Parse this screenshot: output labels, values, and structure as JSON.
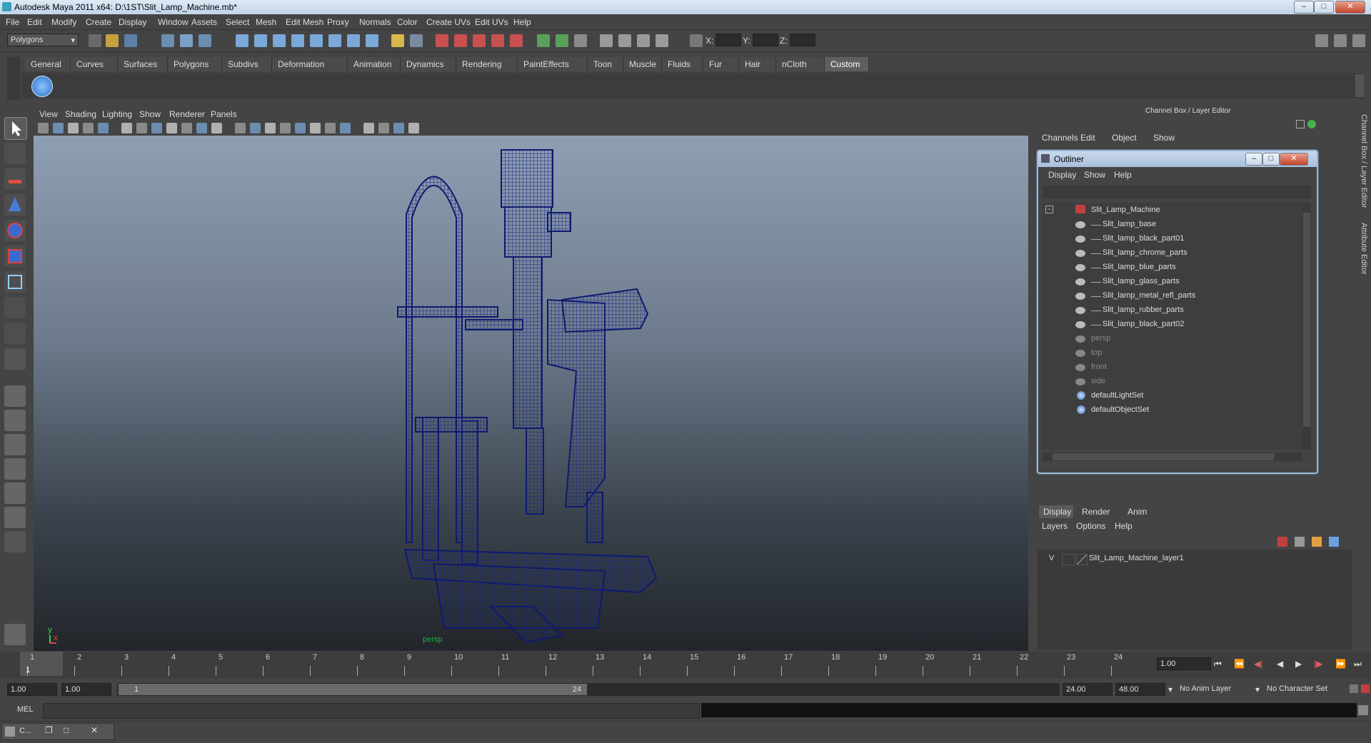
{
  "window": {
    "title": "Autodesk Maya 2011 x64: D:\\1ST\\Slit_Lamp_Machine.mb*"
  },
  "menus": [
    "File",
    "Edit",
    "Modify",
    "Create",
    "Display",
    "Window",
    "Assets",
    "Select",
    "Mesh",
    "Edit Mesh",
    "Proxy",
    "Normals",
    "Color",
    "Create UVs",
    "Edit UVs",
    "Help"
  ],
  "mode_selector": "Polygons",
  "coords": {
    "x_label": "X:",
    "y_label": "Y:",
    "z_label": "Z:"
  },
  "shelf_tabs": [
    "General",
    "Curves",
    "Surfaces",
    "Polygons",
    "Subdivs",
    "Deformation",
    "Animation",
    "Dynamics",
    "Rendering",
    "PaintEffects",
    "Toon",
    "Muscle",
    "Fluids",
    "Fur",
    "Hair",
    "nCloth",
    "Custom"
  ],
  "active_shelf": "Custom",
  "panel_menus": [
    "View",
    "Shading",
    "Lighting",
    "Show",
    "Renderer",
    "Panels"
  ],
  "viewport": {
    "camera_label": "persp",
    "axis_y": "y",
    "axis_x": "x"
  },
  "channel_box": {
    "title": "Channel Box / Layer Editor",
    "menus": [
      "Channels",
      "Edit",
      "Object",
      "Show"
    ],
    "side_tabs": [
      "Channel Box / Layer Editor",
      "Attribute Editor"
    ]
  },
  "outliner": {
    "title": "Outliner",
    "menus": [
      "Display",
      "Show",
      "Help"
    ],
    "root": "Slit_Lamp_Machine",
    "children": [
      "Slit_lamp_base",
      "Slit_lamp_black_part01",
      "Slit_lamp_chrome_parts",
      "Slit_lamp_blue_parts",
      "Slit_lamp_glass_parts",
      "Slit_lamp_metal_refl_parts",
      "Slit_lamp_rubber_parts",
      "Slit_lamp_black_part02"
    ],
    "cameras": [
      "persp",
      "top",
      "front",
      "side"
    ],
    "sets": [
      "defaultLightSet",
      "defaultObjectSet"
    ]
  },
  "layer_editor": {
    "tabs": [
      "Display",
      "Render",
      "Anim"
    ],
    "active_tab": "Display",
    "menus": [
      "Layers",
      "Options",
      "Help"
    ],
    "layer": {
      "visible": "V",
      "name": "Slit_Lamp_Machine_layer1"
    }
  },
  "timeline": {
    "ticks": [
      "1",
      "2",
      "3",
      "4",
      "5",
      "6",
      "7",
      "8",
      "9",
      "10",
      "11",
      "12",
      "13",
      "14",
      "15",
      "16",
      "17",
      "18",
      "19",
      "20",
      "21",
      "22",
      "23",
      "24"
    ],
    "current_frame": "1",
    "current_time_field": "1.00"
  },
  "range": {
    "start": "1.00",
    "playback_start": "1.00",
    "slider_start": "1",
    "slider_end": "24",
    "playback_end": "24.00",
    "end": "48.00",
    "anim_layer": "No Anim Layer",
    "character_set": "No Character Set"
  },
  "command_line": {
    "label": "MEL"
  },
  "taskbar": {
    "item": "C..."
  }
}
